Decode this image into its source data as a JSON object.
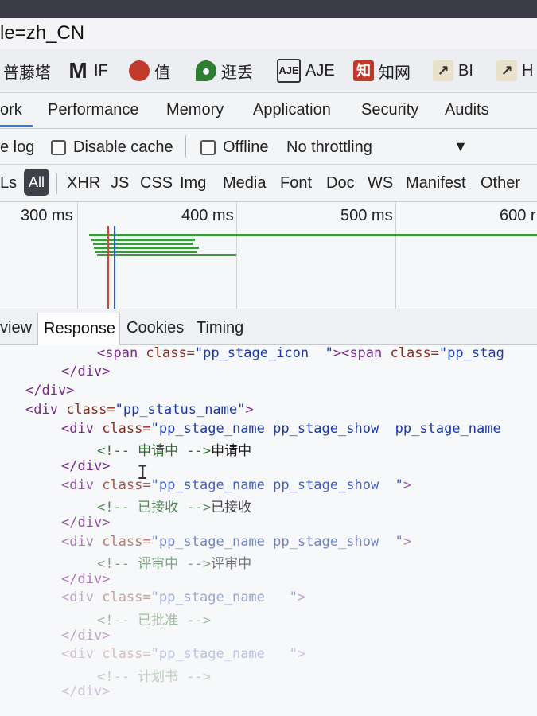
{
  "url_fragment": "le=zh_CN",
  "bookmarks": [
    {
      "icon": "pagoda-icon",
      "label": "普藤塔"
    },
    {
      "icon": "gmail-icon",
      "label": "IF"
    },
    {
      "icon": "circle-red-icon",
      "label": "值"
    },
    {
      "icon": "map-pin-icon",
      "label": "逛丢"
    },
    {
      "icon": "aje-icon",
      "label": "AJE"
    },
    {
      "icon": "zhihu-icon",
      "label": "知网"
    },
    {
      "icon": "bi-icon",
      "label": "BI"
    },
    {
      "icon": "bi-icon",
      "label": "H"
    }
  ],
  "devtools_tabs": [
    "ork",
    "Performance",
    "Memory",
    "Application",
    "Security",
    "Audits"
  ],
  "toolbar": {
    "preserve_log": "e log",
    "disable_cache": "Disable cache",
    "offline": "Offline",
    "throttling": "No throttling"
  },
  "filters": {
    "prefix": "Ls",
    "all": "All",
    "types": [
      "XHR",
      "JS",
      "CSS",
      "Img",
      "Media",
      "Font",
      "Doc",
      "WS",
      "Manifest",
      "Other"
    ]
  },
  "timeline": {
    "ticks": [
      "300 ms",
      "400 ms",
      "500 ms",
      "600 r"
    ]
  },
  "response_tabs": [
    "view",
    "Response",
    "Cookies",
    "Timing"
  ],
  "code": {
    "l1_tag": "<span ",
    "l1_attr": "class=",
    "l1_val": "\"pp_stage_icon  \"",
    "l1_tag2": "><span ",
    "l1_attr2": "class=",
    "l1_val2": "\"pp_stag",
    "l2": "</div>",
    "l3": "</div>",
    "l4_tag": "<div ",
    "l4_attr": "class=",
    "l4_val": "\"pp_status_name\"",
    "l4_end": ">",
    "l5_tag": "<div ",
    "l5_attr": "class=",
    "l5_val": "\"pp_stage_name pp_stage_show  pp_stage_name",
    "l6_cmt": "<!-- 申请中 -->",
    "l6_txt": "申请中",
    "l7": "</div>",
    "l8_tag": "<div ",
    "l8_attr": "class=",
    "l8_val": "\"pp_stage_name pp_stage_show  \"",
    "l8_end": ">",
    "l9_cmt": "<!-- 已接收 -->",
    "l9_txt": "已接收",
    "l10": "</div>",
    "l11_tag": "<div ",
    "l11_attr": "class=",
    "l11_val": "\"pp_stage_name pp_stage_show  \"",
    "l11_end": ">",
    "l12_cmt": "<!-- 评审中 -->",
    "l12_txt": "评审中",
    "l13": "</div>",
    "l14_tag": "<div ",
    "l14_attr": "class=",
    "l14_val": "\"pp_stage_name   \"",
    "l14_end": ">",
    "l15_cmt": "<!-- 已批准 -->",
    "l16": "</div>",
    "l17_tag": "<div ",
    "l17_attr": "class=",
    "l17_val": "\"pp_stage_name   \"",
    "l17_end": ">",
    "l18_cmt": "<!-- 计划书 -->",
    "l19": "</div>"
  }
}
